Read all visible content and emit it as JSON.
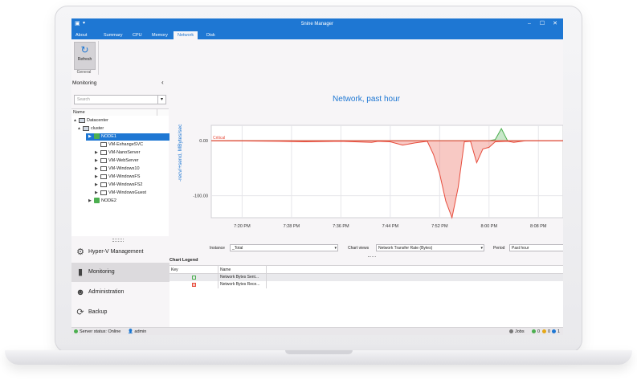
{
  "window": {
    "title": "5nine Manager",
    "menu_tabs": [
      {
        "label": "About",
        "active": false
      },
      {
        "label": "Summary",
        "active": false
      },
      {
        "label": "CPU",
        "active": false
      },
      {
        "label": "Memory",
        "active": false
      },
      {
        "label": "Network",
        "active": true
      },
      {
        "label": "Disk",
        "active": false
      }
    ]
  },
  "ribbon": {
    "refresh_label": "Refresh",
    "group_label": "General"
  },
  "sidebar": {
    "header": "Monitoring",
    "search_placeholder": "Search",
    "tree_column": "Name",
    "tree": [
      {
        "label": "Datacenter",
        "level": 0,
        "expander": "▲"
      },
      {
        "label": "cluster",
        "level": 1,
        "expander": "▲"
      },
      {
        "label": "NODE1",
        "level": 2,
        "expander": "▶",
        "selected": true
      },
      {
        "label": "VM-ExhangeSVC",
        "level": 3,
        "expander": ""
      },
      {
        "label": "VM-NanoServer",
        "level": 3,
        "expander": "▶"
      },
      {
        "label": "VM-WebServer",
        "level": 3,
        "expander": "▶"
      },
      {
        "label": "VM-Windows10",
        "level": 3,
        "expander": "▶"
      },
      {
        "label": "VM-WindowsFS",
        "level": 3,
        "expander": "▶"
      },
      {
        "label": "VM-WindowsFS2",
        "level": 3,
        "expander": "▶"
      },
      {
        "label": "VM-WindowsGuest",
        "level": 3,
        "expander": "▶"
      },
      {
        "label": "NODE2",
        "level": 2,
        "expander": "▶"
      }
    ],
    "nav": [
      {
        "label": "Hyper-V Management",
        "icon": "gears-icon",
        "active": false
      },
      {
        "label": "Monitoring",
        "icon": "bar-chart-icon",
        "active": true
      },
      {
        "label": "Administration",
        "icon": "users-icon",
        "active": false
      },
      {
        "label": "Backup",
        "icon": "backup-icon",
        "active": false
      }
    ]
  },
  "chart_data": {
    "type": "area",
    "title": "Network, past hour",
    "ylabel": "-recv/+send, MBytes/sec",
    "ylim": [
      -140,
      28
    ],
    "yticks": [
      0,
      -100
    ],
    "ytick_labels": [
      "0.00",
      "-100.00"
    ],
    "threshold": {
      "label": "Critical",
      "value": 0
    },
    "xtick_labels": [
      "7:20 PM",
      "7:28 PM",
      "7:36 PM",
      "7:44 PM",
      "7:52 PM",
      "8:00 PM",
      "8:08 PM"
    ],
    "xticks": [
      0,
      8,
      16,
      24,
      32,
      40,
      48
    ],
    "xlim": [
      -5,
      52
    ],
    "series": [
      {
        "name": "Network Bytes Sent...",
        "color": "#4caf50",
        "x": [
          -5,
          40,
          41,
          42,
          43,
          52
        ],
        "values": [
          0,
          0,
          2,
          22,
          0,
          0
        ]
      },
      {
        "name": "Network Bytes Rece...",
        "color": "#e74c3c",
        "x": [
          -5,
          6,
          10,
          16,
          21,
          22,
          24,
          26,
          28,
          30,
          31,
          32,
          33,
          34,
          35,
          36,
          37,
          38,
          39,
          40,
          41,
          43,
          44,
          46,
          52
        ],
        "values": [
          0,
          -1,
          -2,
          -1,
          -3,
          -1,
          -2,
          -8,
          -4,
          -1,
          -25,
          -60,
          -110,
          -140,
          -85,
          -2,
          -1,
          -40,
          -15,
          -12,
          -2,
          -1,
          -3,
          0,
          0
        ]
      }
    ]
  },
  "controls": {
    "instance_label": "Instance",
    "instance_value": "_Total",
    "chart_views_label": "Chart views",
    "chart_views_value": "Network Transfer Rate (Bytes)",
    "period_label": "Period",
    "period_value": "Past hour"
  },
  "legend": {
    "title": "Chart Legend",
    "col_key": "Key",
    "col_name": "Name",
    "rows": [
      {
        "name": "Network Bytes Sent...",
        "color": "#4caf50"
      },
      {
        "name": "Network Bytes Rece...",
        "color": "#e74c3c"
      }
    ]
  },
  "status": {
    "server_status": "Server status: Online",
    "user": "admin",
    "jobs_label": "Jobs",
    "count_ok": "0",
    "count_warn": "0",
    "count_info": "1"
  }
}
